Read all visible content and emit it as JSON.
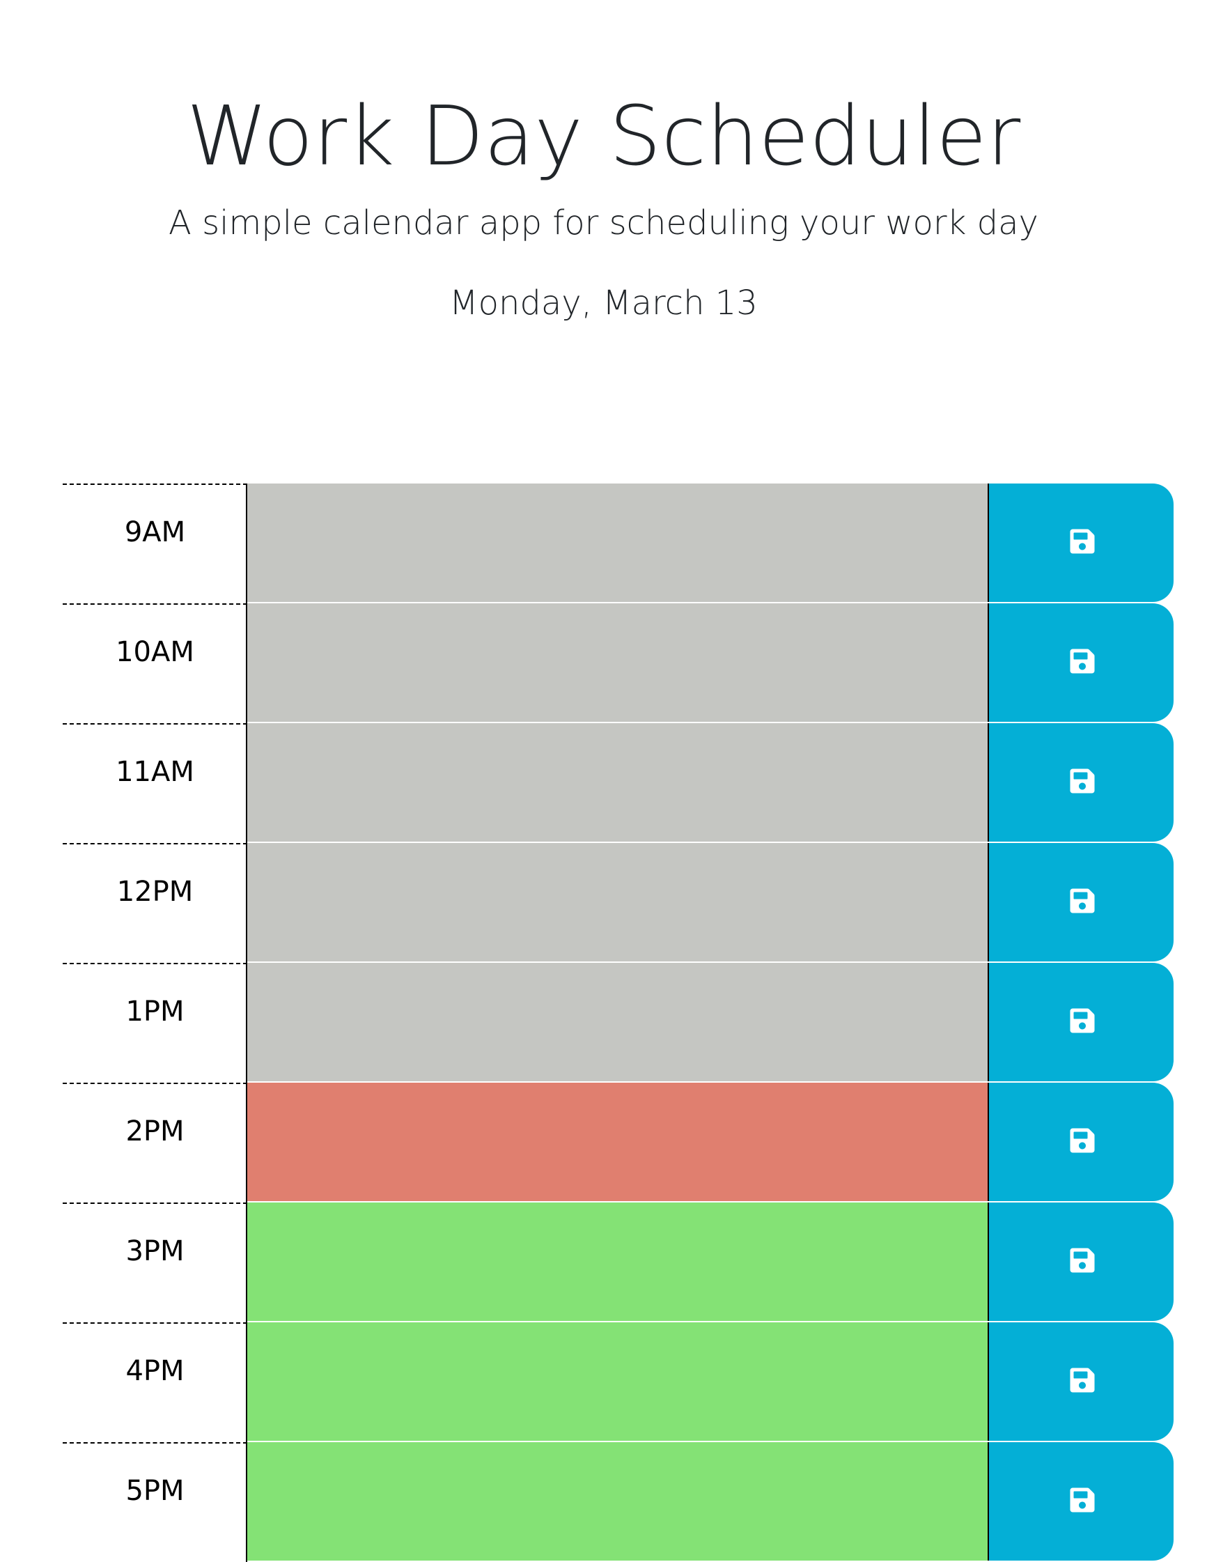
{
  "header": {
    "title": "Work Day Scheduler",
    "subtitle": "A simple calendar app for scheduling your work day",
    "current_day": "Monday, March 13"
  },
  "colors": {
    "past": "#c5c6c2",
    "present": "#e07f6f",
    "future": "#84e275",
    "save_button": "#04afd6"
  },
  "time_blocks": [
    {
      "hour": "9AM",
      "state": "past",
      "text": "",
      "icon": "save-icon"
    },
    {
      "hour": "10AM",
      "state": "past",
      "text": "",
      "icon": "save-icon"
    },
    {
      "hour": "11AM",
      "state": "past",
      "text": "",
      "icon": "save-icon"
    },
    {
      "hour": "12PM",
      "state": "past",
      "text": "",
      "icon": "save-icon"
    },
    {
      "hour": "1PM",
      "state": "past",
      "text": "",
      "icon": "save-icon"
    },
    {
      "hour": "2PM",
      "state": "present",
      "text": "",
      "icon": "save-icon"
    },
    {
      "hour": "3PM",
      "state": "future",
      "text": "",
      "icon": "save-icon"
    },
    {
      "hour": "4PM",
      "state": "future",
      "text": "",
      "icon": "save-icon"
    },
    {
      "hour": "5PM",
      "state": "future",
      "text": "",
      "icon": "save-icon"
    }
  ]
}
